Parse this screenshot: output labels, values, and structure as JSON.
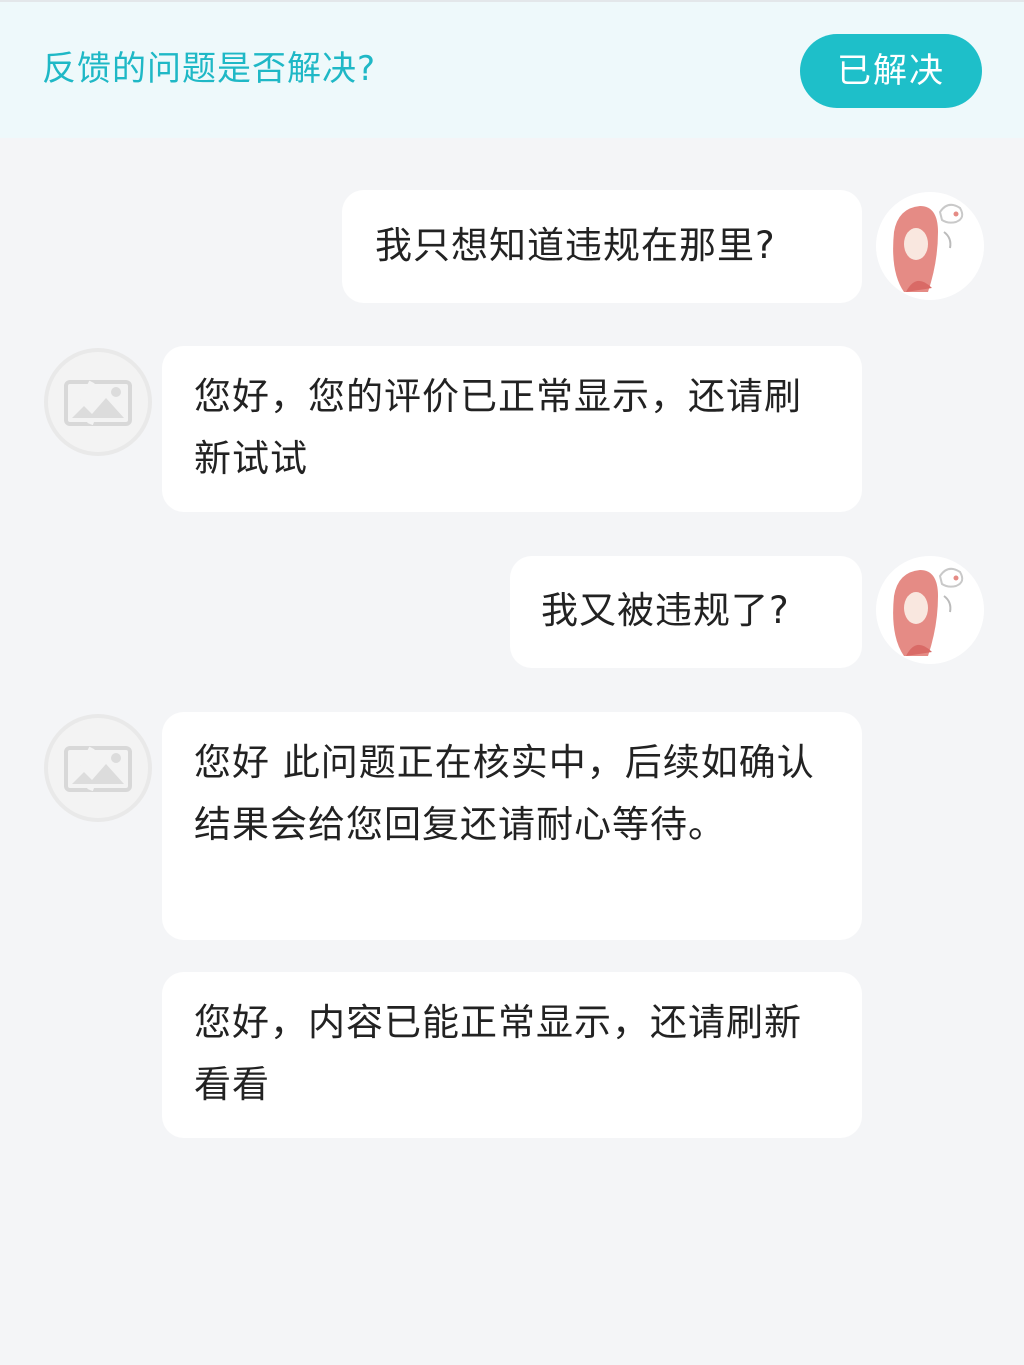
{
  "banner": {
    "question": "反馈的问题是否解决?",
    "resolved_label": "已解决"
  },
  "colors": {
    "accent": "#1ebfc9",
    "banner_bg": "#eef9fb",
    "page_bg": "#f4f5f7",
    "bubble_bg": "#ffffff",
    "text": "#222222"
  },
  "messages": [
    {
      "sender": "user",
      "text": "我只想知道违规在那里?",
      "avatar": "user-avatar-icon"
    },
    {
      "sender": "agent",
      "text": "您好，您的评价已正常显示，还请刷新试试",
      "avatar": "broken-image-icon"
    },
    {
      "sender": "user",
      "text": "我又被违规了?",
      "avatar": "user-avatar-icon"
    },
    {
      "sender": "agent",
      "text": "您好 此问题正在核实中，后续如确认结果会给您回复还请耐心等待。",
      "avatar": "broken-image-icon"
    },
    {
      "sender": "agent",
      "text": "您好，内容已能正常显示，还请刷新看看"
    }
  ]
}
